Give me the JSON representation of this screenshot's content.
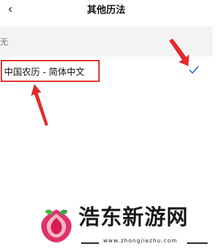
{
  "header": {
    "back_icon": "‹",
    "title": "其他历法"
  },
  "section": {
    "label": "无"
  },
  "option": {
    "label": "中国农历 - 简体中文",
    "selected": true
  },
  "watermark": {
    "name": "浩东新游网",
    "url": "www.zhongjiezhu.com"
  },
  "colors": {
    "accent": "#3b78d8",
    "highlight": "#e32a2a",
    "section_bg": "#f3f3f6"
  }
}
